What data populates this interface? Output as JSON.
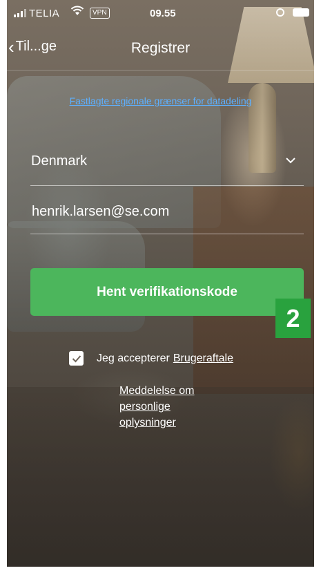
{
  "status_bar": {
    "carrier": "TELIA",
    "vpn": "VPN",
    "time": "09.55"
  },
  "nav": {
    "back_label": "Til...ge",
    "title": "Registrer"
  },
  "region_link": "Fastlagte regionale grænser for datadeling",
  "country": {
    "value": "Denmark"
  },
  "email": {
    "value": "henrik.larsen@se.com"
  },
  "primary_button": "Hent verifikationskode",
  "step_badge": "2",
  "agreement": {
    "checked": true,
    "text": "Jeg accepterer",
    "link": "Brugeraftale"
  },
  "privacy_link": "Meddelelse om personlige oplysninger",
  "colors": {
    "accent_green": "#4cb65c",
    "badge_green": "#29a23e",
    "link_blue": "#5db0ff"
  }
}
